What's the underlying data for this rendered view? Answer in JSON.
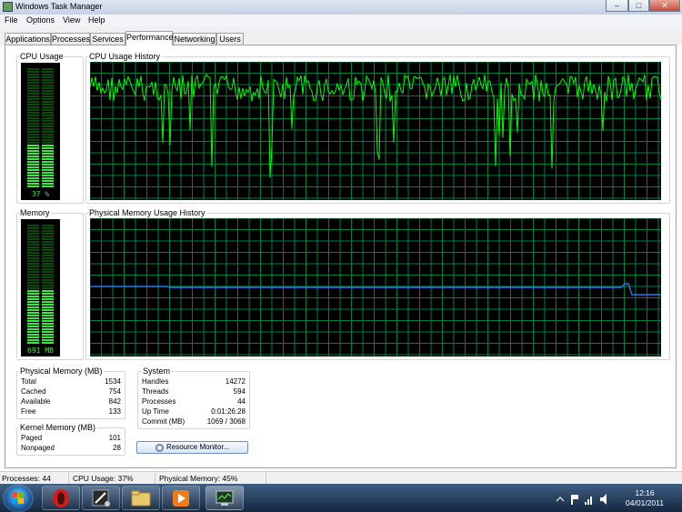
{
  "window": {
    "title": "Windows Task Manager",
    "minimize_glyph": "–",
    "maximize_glyph": "□",
    "close_glyph": "✕"
  },
  "menu": [
    "File",
    "Options",
    "View",
    "Help"
  ],
  "tabs": [
    "Applications",
    "Processes",
    "Services",
    "Performance",
    "Networking",
    "Users"
  ],
  "active_tab": "Performance",
  "cpu_usage": {
    "label": "CPU Usage",
    "value_text": "37 %",
    "fraction": 0.37
  },
  "cpu_history": {
    "label": "CPU Usage History"
  },
  "memory": {
    "label": "Memory",
    "value_text": "691 MB",
    "fraction": 0.45
  },
  "memory_history": {
    "label": "Physical Memory Usage History"
  },
  "physical_memory": {
    "label": "Physical Memory (MB)",
    "rows": [
      {
        "key": "Total",
        "value": "1534"
      },
      {
        "key": "Cached",
        "value": "754"
      },
      {
        "key": "Available",
        "value": "842"
      },
      {
        "key": "Free",
        "value": "133"
      }
    ]
  },
  "kernel_memory": {
    "label": "Kernel Memory (MB)",
    "rows": [
      {
        "key": "Paged",
        "value": "101"
      },
      {
        "key": "Nonpaged",
        "value": "28"
      }
    ]
  },
  "system": {
    "label": "System",
    "rows": [
      {
        "key": "Handles",
        "value": "14272"
      },
      {
        "key": "Threads",
        "value": "594"
      },
      {
        "key": "Processes",
        "value": "44"
      },
      {
        "key": "Up Time",
        "value": "0:01:26:28"
      },
      {
        "key": "Commit (MB)",
        "value": "1069 / 3068"
      }
    ]
  },
  "resource_monitor_button": "Resource Monitor...",
  "status": {
    "processes": "Processes: 44",
    "cpu": "CPU Usage: 37%",
    "memory": "Physical Memory: 45%"
  },
  "taskbar": {
    "items": [
      "opera-browser",
      "media-app",
      "file-explorer",
      "media-player",
      "task-manager"
    ],
    "clock_time": "12:16",
    "clock_date": "04/01/2011"
  },
  "colors": {
    "graph_bg": "#000000",
    "grid": "#008040",
    "cpu_line": "#00ff00",
    "memory_line": "#1e7bff",
    "gauge_on": "#3fe63f",
    "gauge_off": "#0a4a0a"
  }
}
